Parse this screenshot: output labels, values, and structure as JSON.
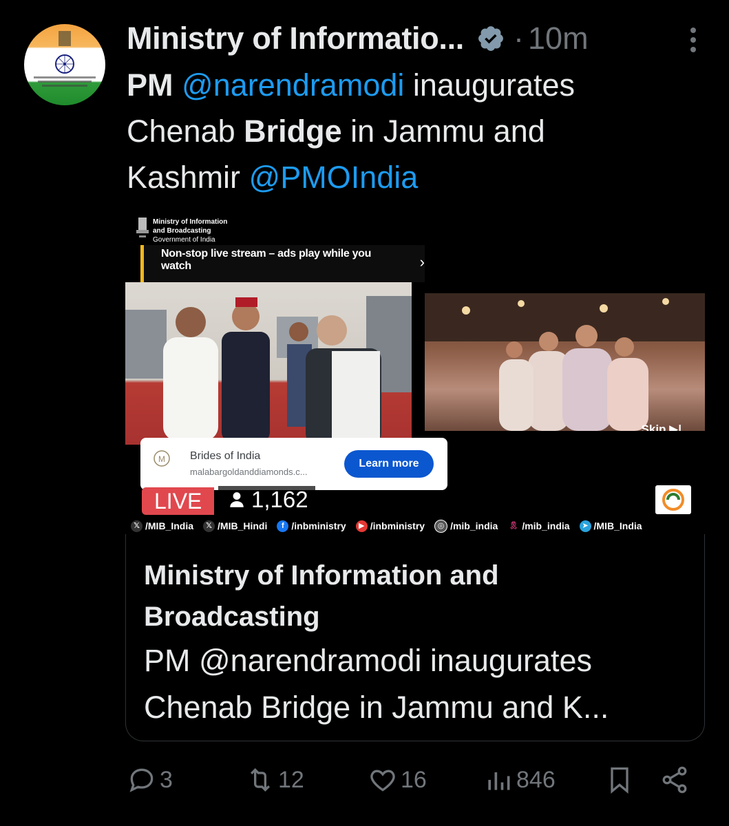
{
  "tweet": {
    "author_name": "Ministry of Informatio...",
    "separator": "·",
    "time": "10m",
    "text": {
      "w1": "PM",
      "mention1": "@narendramodi",
      "w2": " inaugurates",
      "w3": "Chenab ",
      "w4": "Bridge",
      "w5": " in Jammu and",
      "w6": "Kashmir ",
      "mention2": "@PMOIndia"
    }
  },
  "video": {
    "mib_line1": "Ministry of Information",
    "mib_line2": "and Broadcasting",
    "mib_line3": "Government of India",
    "stream_notice": "Non-stop live stream – ads play while you watch",
    "skip_label": "Skip",
    "ad": {
      "title": "Brides of India",
      "url": "malabargoldanddiamonds.c...",
      "button": "Learn more"
    },
    "live_label": "LIVE",
    "viewer_count": "1,162",
    "social": [
      {
        "icon": "x-icon",
        "handle": "/MIB_India"
      },
      {
        "icon": "x-icon",
        "handle": "/MIB_Hindi"
      },
      {
        "icon": "facebook-icon",
        "handle": "/inbministry"
      },
      {
        "icon": "youtube-icon",
        "handle": "/inbministry"
      },
      {
        "icon": "instagram-icon",
        "handle": "/mib_india"
      },
      {
        "icon": "koo-icon",
        "handle": "/mib_india"
      },
      {
        "icon": "telegram-icon",
        "handle": "/MIB_India"
      }
    ]
  },
  "card": {
    "title": "Ministry of Information and Broadcasting",
    "description": "PM @narendramodi inaugurates Chenab Bridge in Jammu and K..."
  },
  "actions": {
    "replies": "3",
    "reposts": "12",
    "likes": "16",
    "views": "846"
  },
  "colors": {
    "background": "#000000",
    "text": "#e7e9ea",
    "muted": "#71767b",
    "link": "#1d9bf0",
    "live_red": "#e0484e",
    "ad_button": "#0b57d0"
  }
}
